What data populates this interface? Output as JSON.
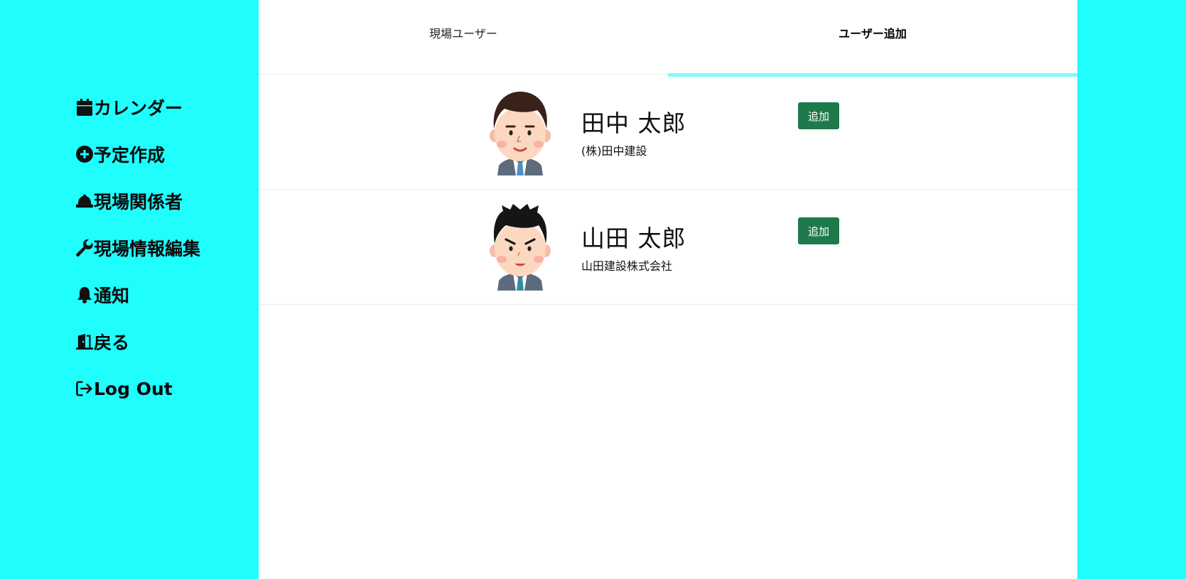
{
  "colors": {
    "sidebar_bg": "#1ffdfd",
    "active_tab_indicator": "#7ffdf6",
    "add_button": "#1e7a4a"
  },
  "sidebar": {
    "items": [
      {
        "label": "カレンダー",
        "icon": "calendar-icon"
      },
      {
        "label": "予定作成",
        "icon": "plus-circle-icon"
      },
      {
        "label": "現場関係者",
        "icon": "hard-hat-icon"
      },
      {
        "label": "現場情報編集",
        "icon": "wrench-icon"
      },
      {
        "label": "通知",
        "icon": "bell-icon"
      },
      {
        "label": "戻る",
        "icon": "door-open-icon"
      },
      {
        "label": "Log Out",
        "icon": "logout-icon"
      }
    ]
  },
  "tabs": [
    {
      "label": "現場ユーザー",
      "active": false
    },
    {
      "label": "ユーザー追加",
      "active": true
    }
  ],
  "users": [
    {
      "name": "田中 太郎",
      "company": "(株)田中建設",
      "button_label": "追加",
      "avatar": "avatar-man-brown-hair"
    },
    {
      "name": "山田 太郎",
      "company": "山田建設株式会社",
      "button_label": "追加",
      "avatar": "avatar-man-black-hair"
    }
  ]
}
